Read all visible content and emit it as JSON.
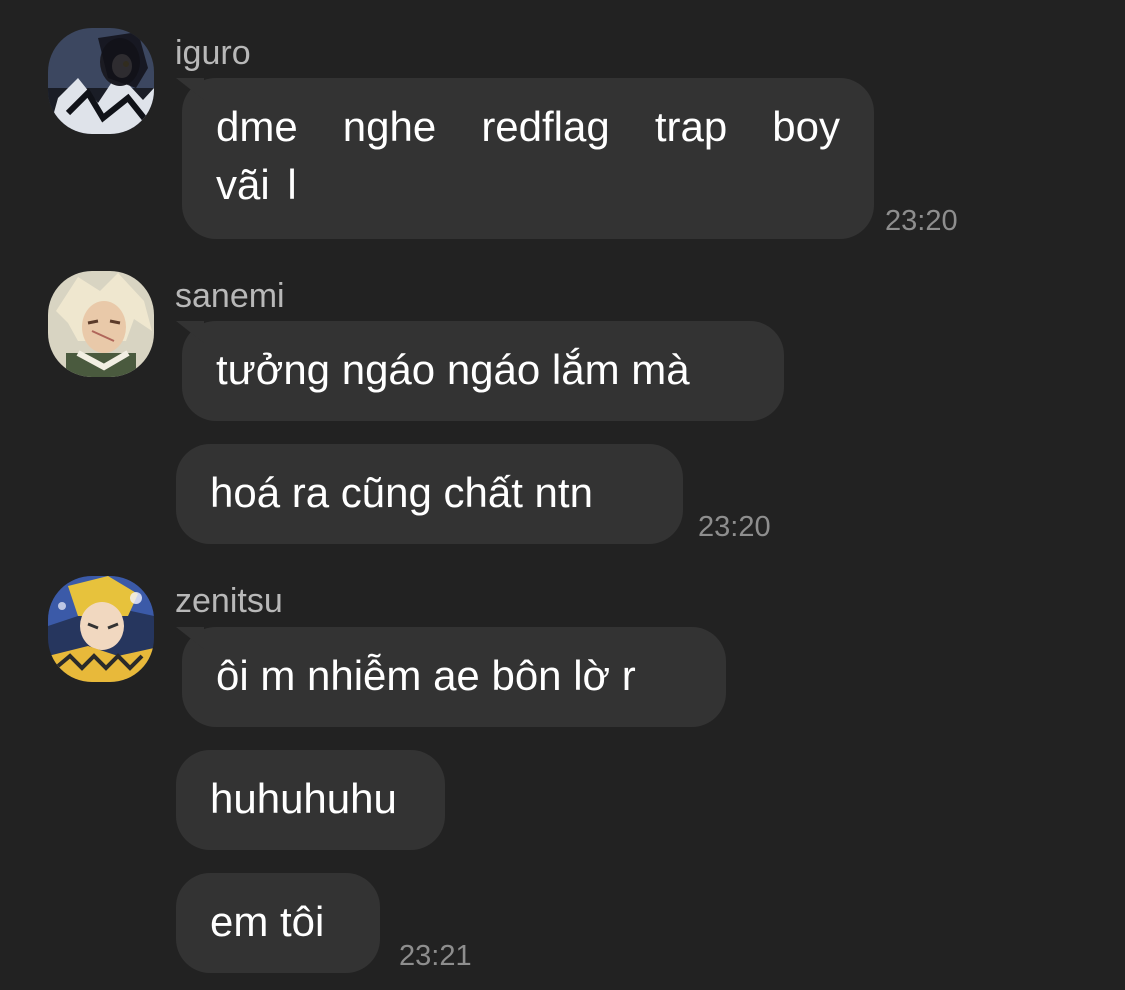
{
  "groups": [
    {
      "sender": "iguro",
      "avatar": "iguro-avatar",
      "messages": [
        "dme  nghe  redflag  trap  boy vãi l"
      ],
      "time": "23:20"
    },
    {
      "sender": "sanemi",
      "avatar": "sanemi-avatar",
      "messages": [
        "tưởng ngáo ngáo lắm mà",
        "hoá ra cũng chất ntn"
      ],
      "time": "23:20"
    },
    {
      "sender": "zenitsu",
      "avatar": "zenitsu-avatar",
      "messages": [
        "ôi m nhiễm ae bôn lờ r",
        "huhuhuhu",
        "em tôi"
      ],
      "time": "23:21"
    }
  ],
  "colors": {
    "background": "#222222",
    "bubble": "#333333",
    "text": "#ffffff",
    "sender": "#b8b8b8",
    "timestamp": "#8e8e8e"
  }
}
